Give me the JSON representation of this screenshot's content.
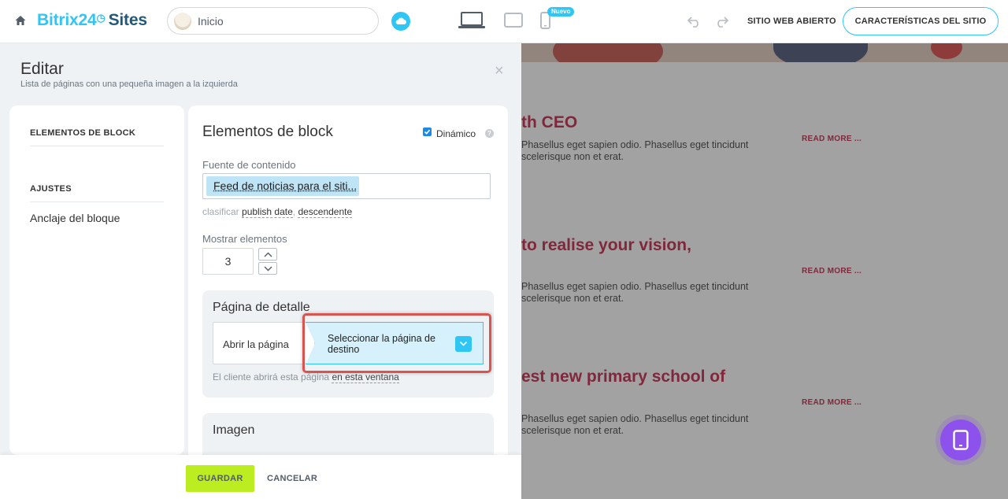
{
  "topbar": {
    "logo_brand": "Bitrix24",
    "logo_clock": "◷",
    "logo_product": "Sites",
    "page_selector": "Inicio",
    "new_badge": "Nuevo",
    "open_site": "SITIO WEB ABIERTO",
    "site_features": "CARACTERÍSTICAS DEL SITIO",
    "icons": [
      "home-icon",
      "cloud-icon",
      "laptop-icon",
      "tablet-icon",
      "phone-icon",
      "undo-icon",
      "redo-icon"
    ]
  },
  "panel": {
    "title": "Editar",
    "subtitle": "Lista de páginas con una pequeña imagen a la izquierda",
    "close": "×",
    "nav": {
      "elements_heading": "ELEMENTOS DE BLOCK",
      "settings_heading": "AJUSTES",
      "anchor_item": "Anclaje del bloque"
    },
    "form": {
      "title": "Elementos de block",
      "dynamic_label": "Dinámico",
      "dynamic_checked": true,
      "help": "?",
      "source_label": "Fuente de contenido",
      "source_value": "Feed de noticias para el siti...",
      "sort_label": "clasificar",
      "sort_field": "publish date",
      "sort_separator": ",",
      "sort_order": "descendente",
      "show_label": "Mostrar elementos",
      "show_value": "3",
      "detail": {
        "title": "Página de detalle",
        "open_page": "Abrir la página",
        "target_select": "Seleccionar la página de destino",
        "hint_prefix": "El cliente abrirá esta página",
        "hint_link": "en esta ventana"
      },
      "image_title": "Imagen"
    },
    "footer": {
      "save": "GUARDAR",
      "cancel": "CANCELAR"
    }
  },
  "preview": {
    "items": [
      {
        "title": "th CEO",
        "text": "Phasellus eget sapien odio. Phasellus eget tincidunt scelerisque non et erat.",
        "read_more": "READ MORE ..."
      },
      {
        "title": "to realise your vision,",
        "text": "Phasellus eget sapien odio. Phasellus eget tincidunt scelerisque non et erat.",
        "read_more": "READ MORE ..."
      },
      {
        "title": "est new primary school of",
        "text": "Phasellus eget sapien odio. Phasellus eget tincidunt scelerisque non et erat.",
        "read_more": "READ MORE ..."
      }
    ]
  },
  "colors": {
    "accent": "#2fc6f6",
    "save": "#bbed21",
    "headline": "#c0143c",
    "highlight": "#d9534f",
    "mobile_fab": "#8e52ec"
  }
}
